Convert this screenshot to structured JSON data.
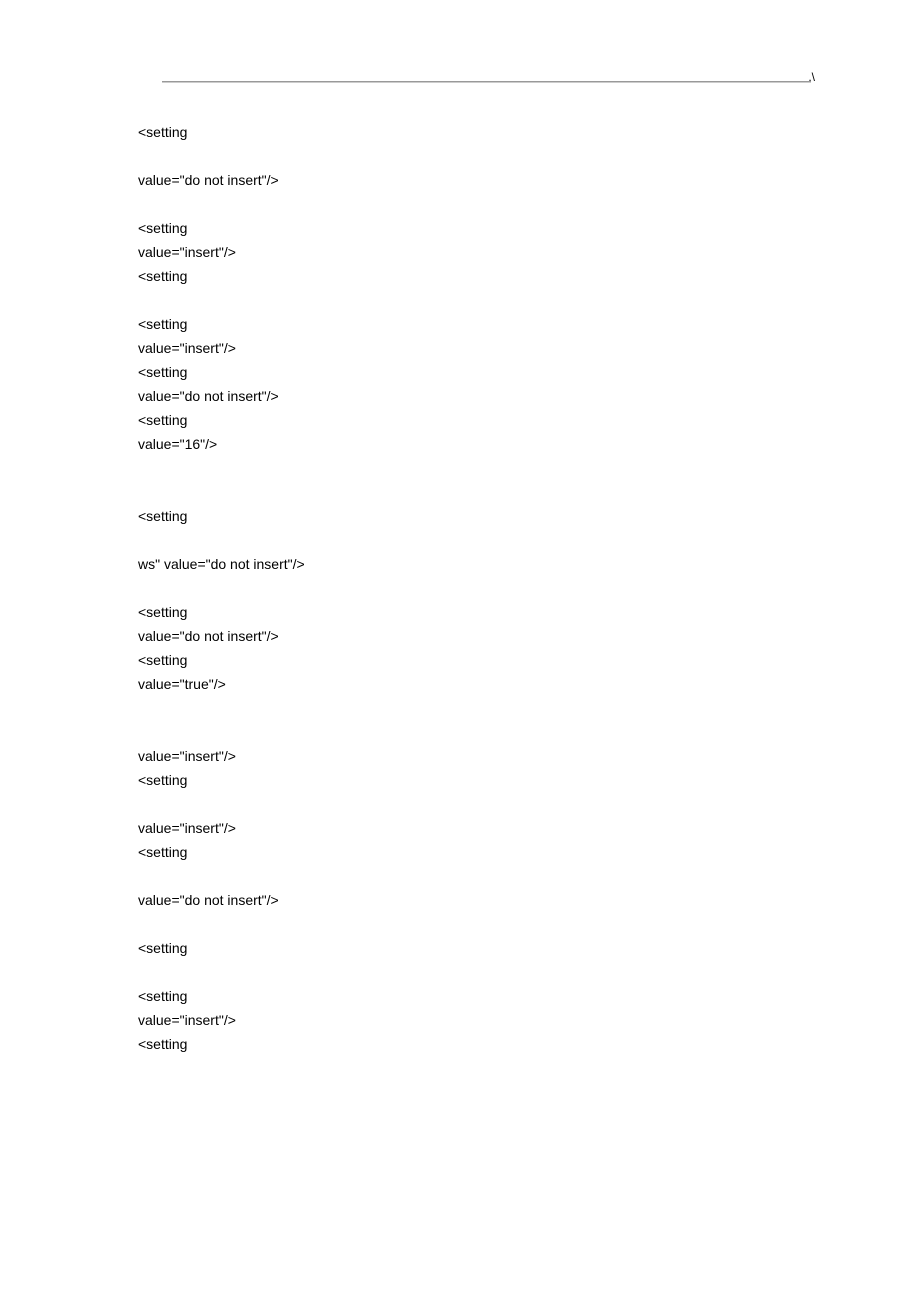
{
  "header": {
    "mark": ".\\"
  },
  "lines": [
    "<setting",
    "",
    "value=\"do not insert\"/>",
    "",
    "<setting",
    "value=\"insert\"/>",
    "<setting",
    "",
    "<setting",
    "value=\"insert\"/>",
    "<setting",
    "value=\"do not insert\"/>",
    "<setting",
    "value=\"16\"/>",
    "",
    "",
    "<setting",
    "",
    "ws\" value=\"do not insert\"/>",
    "",
    "<setting",
    "value=\"do not insert\"/>",
    "<setting",
    "value=\"true\"/>",
    "",
    "",
    "value=\"insert\"/>",
    "<setting",
    "",
    "value=\"insert\"/>",
    "<setting",
    "",
    "value=\"do not insert\"/>",
    "",
    "<setting",
    "",
    "<setting",
    "value=\"insert\"/>",
    "<setting"
  ]
}
